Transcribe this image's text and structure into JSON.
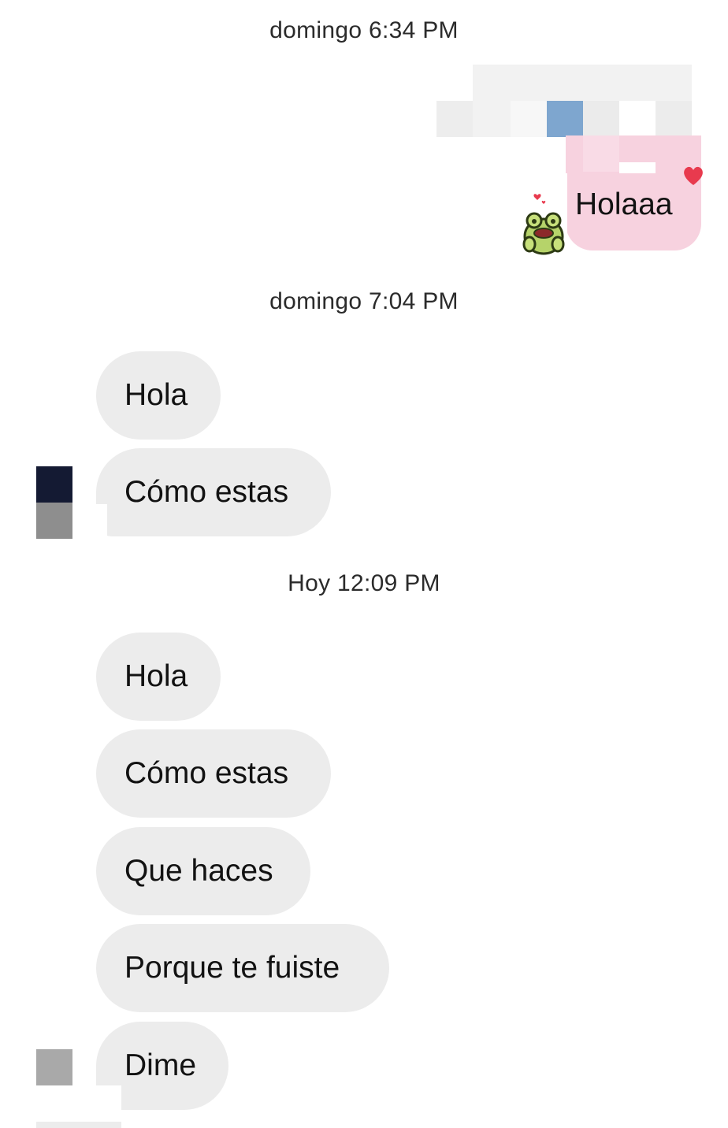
{
  "conversation": {
    "timestamps": {
      "t1": "domingo 6:34 PM",
      "t2": "domingo 7:04 PM",
      "t3": "Hoy 12:09 PM"
    },
    "sent_messages": [
      {
        "text": "Holaaa",
        "sticker": "frog-sticker-icon"
      }
    ],
    "received_group_1": [
      {
        "text": "Hola"
      },
      {
        "text": "Cómo estas"
      }
    ],
    "received_group_2": [
      {
        "text": "Hola"
      },
      {
        "text": "Cómo estas"
      },
      {
        "text": "Que haces"
      },
      {
        "text": "Porque te fuiste"
      },
      {
        "text": "Dime"
      }
    ]
  },
  "colors": {
    "received_bubble": "#ececec",
    "sent_bubble": "#f7d2df",
    "timestamp_text": "#2b2b2b",
    "heart": "#e83a4e"
  }
}
